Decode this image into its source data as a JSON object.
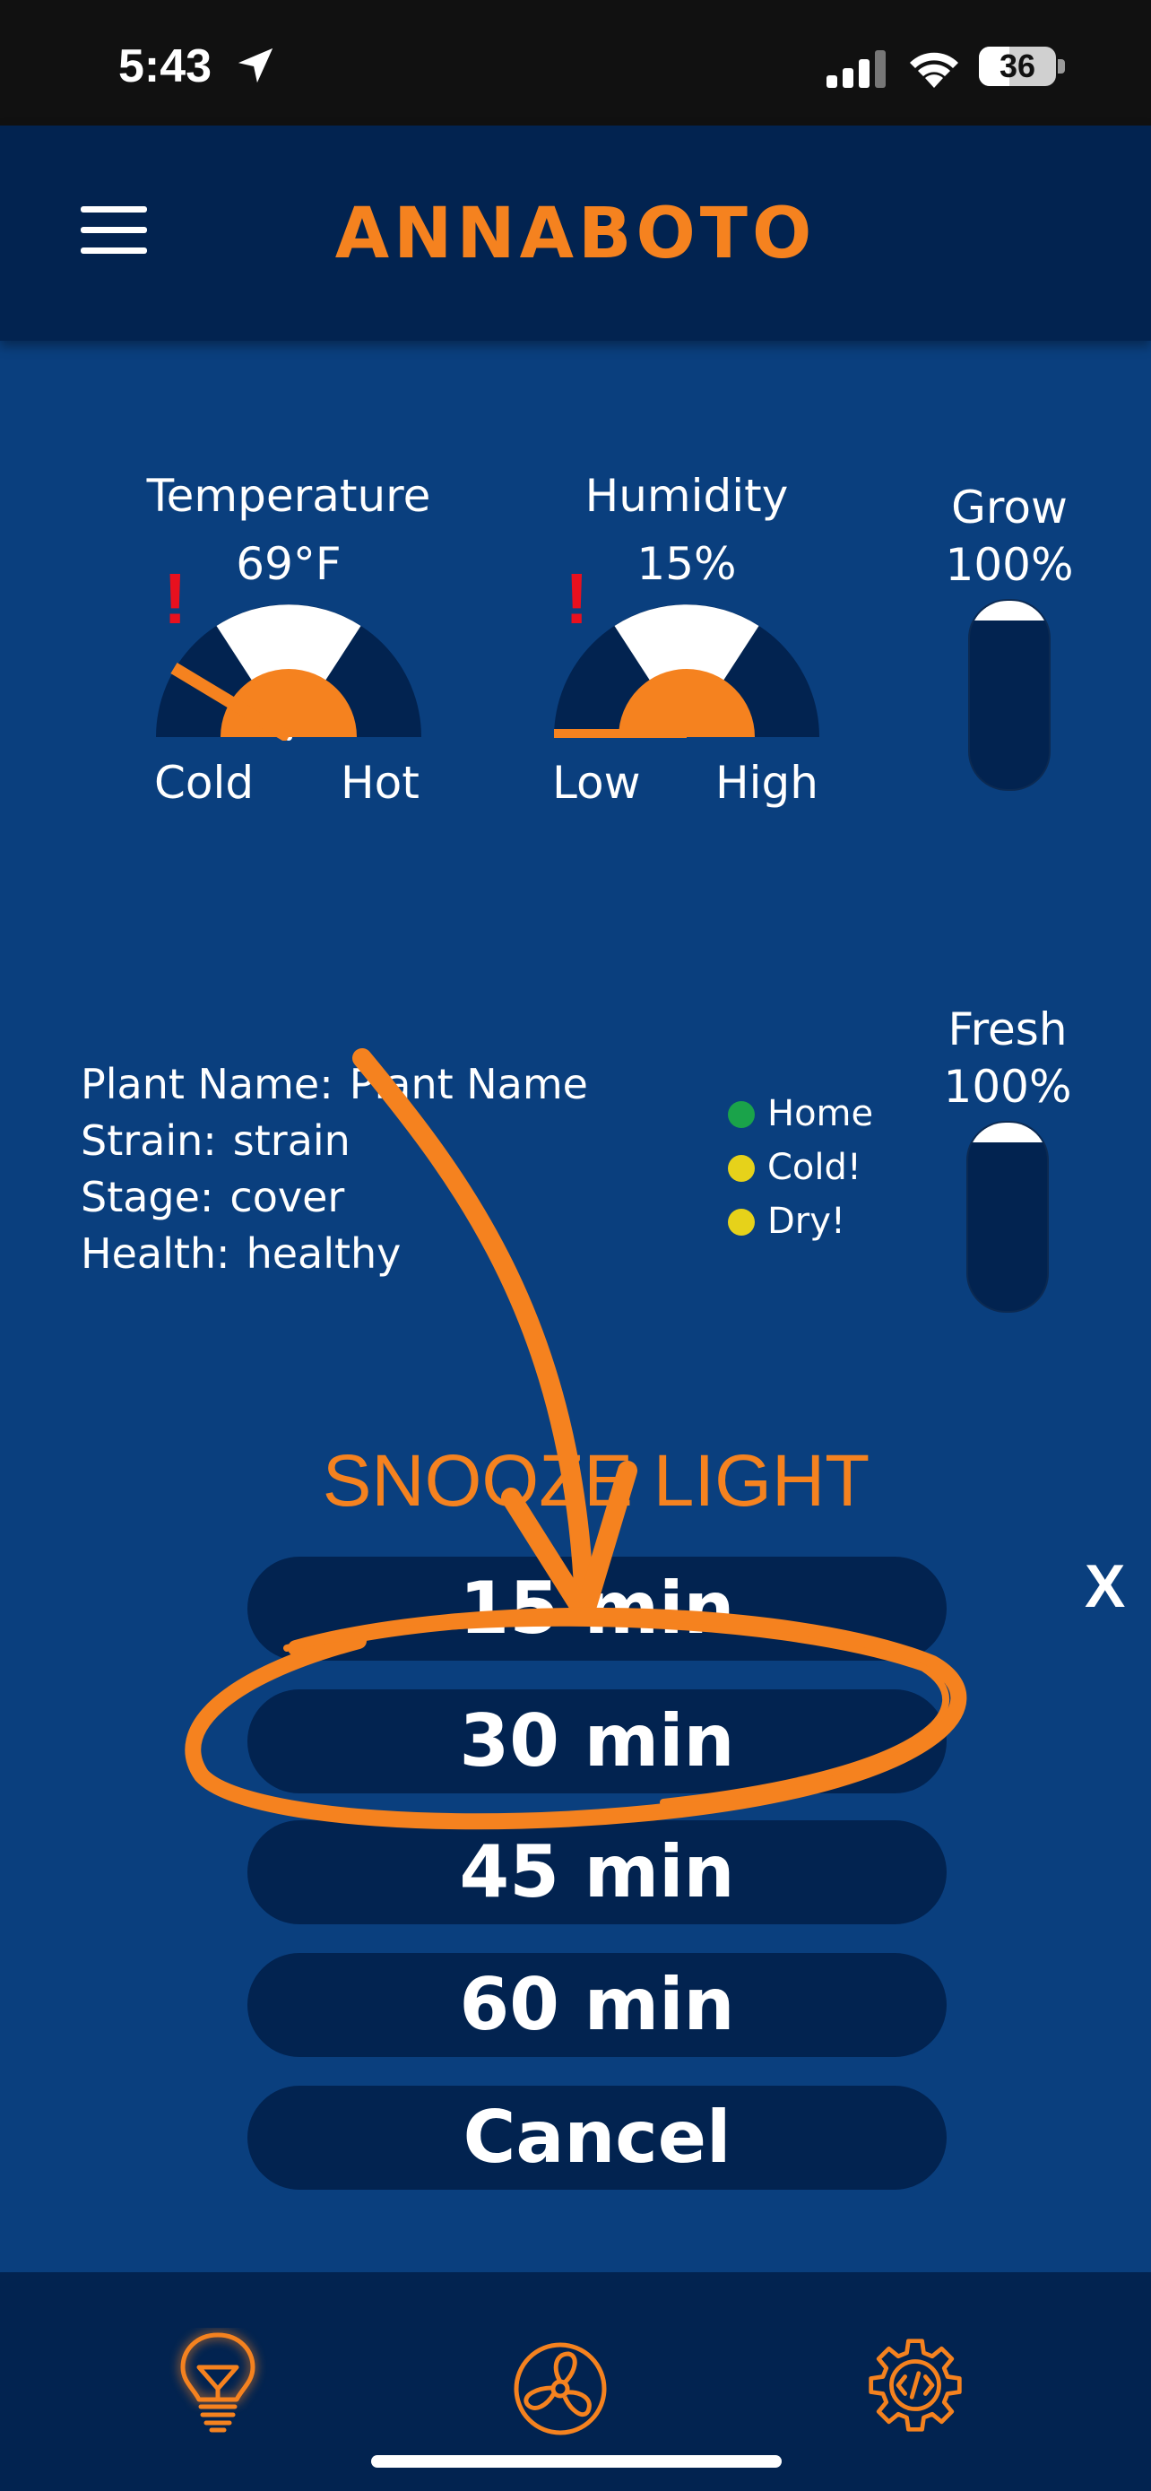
{
  "status_bar": {
    "time": "5:43",
    "battery": "36"
  },
  "header": {
    "title": "ANNABOTO"
  },
  "gauges": [
    {
      "title": "Temperature",
      "value": "69°F",
      "low_label": "Cold",
      "high_label": "Hot",
      "alert": "!"
    },
    {
      "title": "Humidity",
      "value": "15%",
      "low_label": "Low",
      "high_label": "High",
      "alert": "!"
    }
  ],
  "sliders": [
    {
      "label": "Grow",
      "value": "100%"
    },
    {
      "label": "Fresh",
      "value": "100%"
    }
  ],
  "plant": {
    "name_label": "Plant Name:",
    "name_value": "Plant Name",
    "strain_label": "Strain:",
    "strain_value": "strain",
    "stage_label": "Stage:",
    "stage_value": "cover",
    "health_label": "Health:",
    "health_value": "healthy"
  },
  "status_indicators": [
    {
      "label": "Home",
      "color": "#1aa34a"
    },
    {
      "label": "Cold!",
      "color": "#e6d21a"
    },
    {
      "label": "Dry!",
      "color": "#e6d21a"
    }
  ],
  "snooze": {
    "title": "SNOOZE LIGHT",
    "options": [
      "15 min",
      "30 min",
      "45 min",
      "60 min"
    ],
    "cancel": "Cancel",
    "close": "X"
  },
  "bottom_nav": [
    "lightbulb-icon",
    "fan-icon",
    "gear-code-icon"
  ],
  "colors": {
    "accent": "#f5821f",
    "header": "#022350",
    "background": "#0a3f7e",
    "alert": "#e8101e"
  }
}
